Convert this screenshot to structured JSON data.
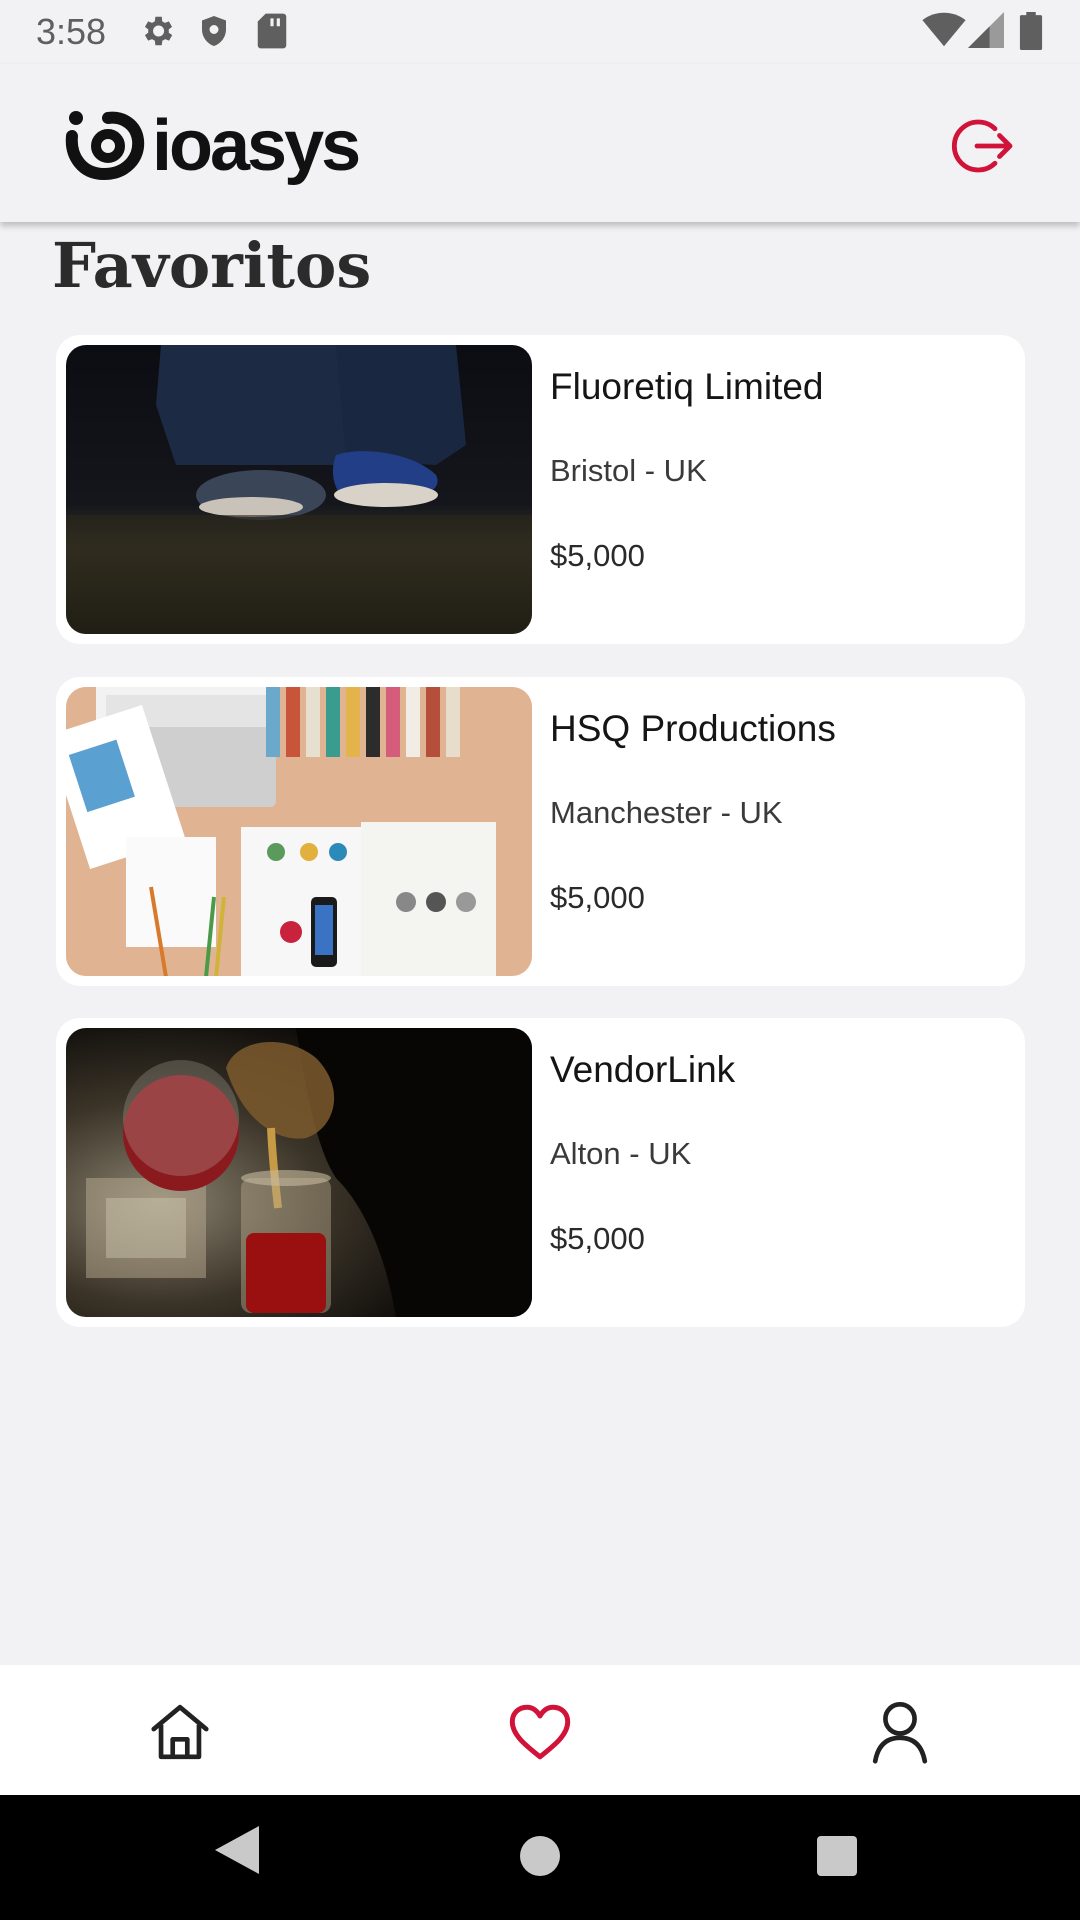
{
  "status_bar": {
    "time": "3:58",
    "icons_left": [
      "gear-icon",
      "shield-icon",
      "sd-card-icon"
    ],
    "icons_right": [
      "wifi-icon",
      "signal-icon",
      "battery-icon"
    ]
  },
  "app_bar": {
    "logo_text": "ioasys",
    "logout_icon": "logout-icon",
    "accent_color": "#d1133a"
  },
  "page": {
    "title": "Favoritos"
  },
  "favorites": [
    {
      "name": "Fluoretiq Limited",
      "location": "Bristol - UK",
      "price": "$5,000"
    },
    {
      "name": "HSQ Productions",
      "location": "Manchester - UK",
      "price": "$5,000"
    },
    {
      "name": "VendorLink",
      "location": "Alton - UK",
      "price": "$5,000"
    }
  ],
  "bottom_nav": {
    "items": [
      "home-icon",
      "heart-icon",
      "user-icon"
    ],
    "active": "heart-icon"
  },
  "system_nav": [
    "back-icon",
    "home-circle-icon",
    "recents-icon"
  ]
}
